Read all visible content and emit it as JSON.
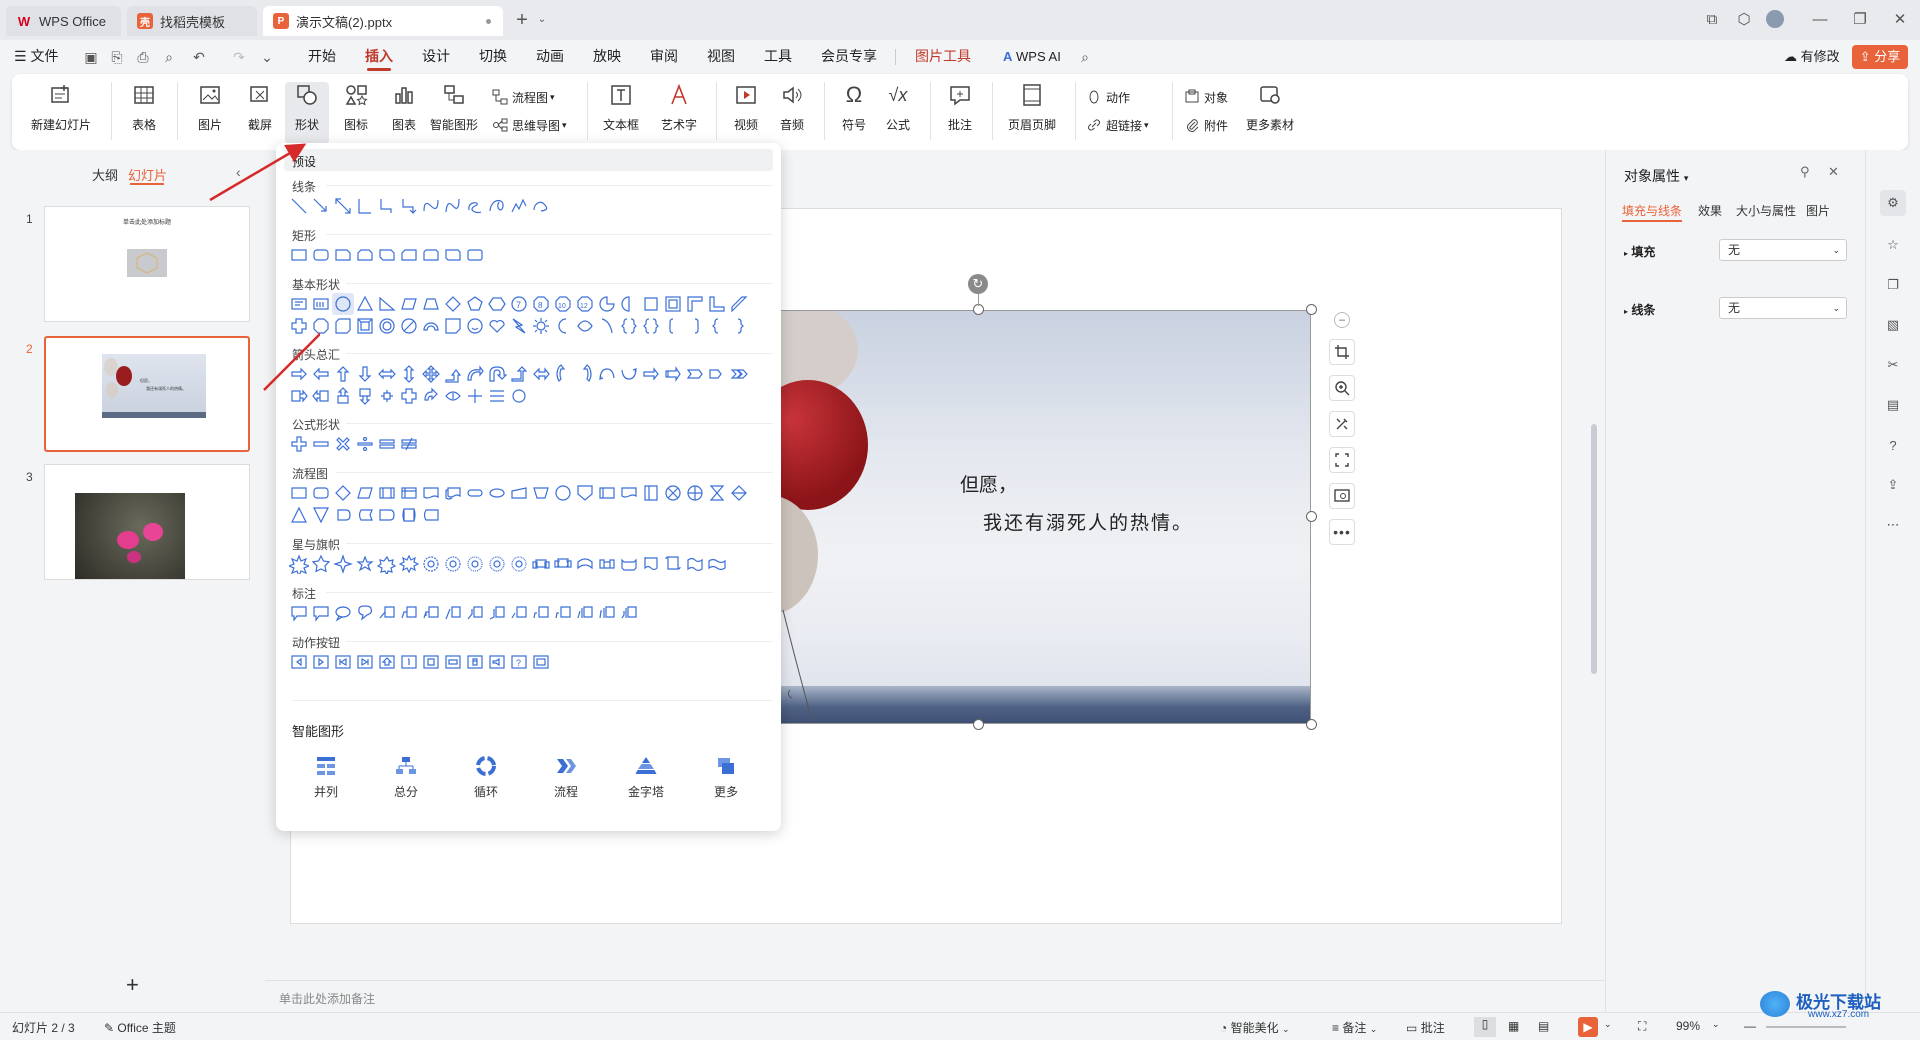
{
  "tabs": [
    {
      "label": "WPS Office",
      "color": "#d9001b"
    },
    {
      "label": "找稻壳模板",
      "color": "#e8623a"
    },
    {
      "label": "演示文稿(2).pptx",
      "color": "#e8623a"
    }
  ],
  "menu": {
    "file": "文件",
    "items": [
      "开始",
      "插入",
      "设计",
      "切换",
      "动画",
      "放映",
      "审阅",
      "视图",
      "工具",
      "会员专享"
    ],
    "active": "插入",
    "picture_tools": "图片工具",
    "wps_ai": "WPS AI",
    "has_changes": "有修改",
    "share": "分享"
  },
  "ribbon": {
    "new_slide": "新建幻灯片",
    "table": "表格",
    "picture": "图片",
    "screenshot": "截屏",
    "shape": "形状",
    "icon": "图标",
    "chart": "图表",
    "smartart": "智能图形",
    "flowchart": "流程图",
    "mindmap": "思维导图",
    "textbox": "文本框",
    "wordart": "艺术字",
    "video": "视频",
    "audio": "音频",
    "symbol": "符号",
    "formula": "公式",
    "comment": "批注",
    "header_footer": "页眉页脚",
    "action": "动作",
    "hyperlink": "超链接",
    "object": "对象",
    "attachment": "附件",
    "more_material": "更多素材"
  },
  "left_panel": {
    "tab_outline": "大纲",
    "tab_slides": "幻灯片",
    "slides": [
      {
        "num": "1",
        "title": "单击此处添加标题"
      },
      {
        "num": "2",
        "text1": "但愿，",
        "text2": "我还有溺死人的热情。"
      },
      {
        "num": "3"
      }
    ],
    "add": "+"
  },
  "slide": {
    "line1": "但愿，",
    "line2": "我还有溺死人的热情。"
  },
  "shapes_dropdown": {
    "preset": "预设",
    "sections": [
      {
        "title": "线条",
        "count": 12
      },
      {
        "title": "矩形",
        "count": 9
      },
      {
        "title": "基本形状",
        "count": 42
      },
      {
        "title": "箭头总汇",
        "count": 32
      },
      {
        "title": "公式形状",
        "count": 6
      },
      {
        "title": "流程图",
        "count": 28
      },
      {
        "title": "星与旗帜",
        "count": 20
      },
      {
        "title": "标注",
        "count": 16
      },
      {
        "title": "动作按钮",
        "count": 12
      }
    ],
    "smart_title": "智能图形",
    "smart_items": [
      "并列",
      "总分",
      "循环",
      "流程",
      "金字塔",
      "更多"
    ]
  },
  "right_panel": {
    "title": "对象属性",
    "tabs": [
      "填充与线条",
      "效果",
      "大小与属性",
      "图片"
    ],
    "fill_label": "填充",
    "fill_value": "无",
    "line_label": "线条",
    "line_value": "无"
  },
  "notes_placeholder": "单击此处添加备注",
  "status": {
    "slide_info": "幻灯片 2 / 3",
    "theme": "Office 主题",
    "beautify": "智能美化",
    "notes": "备注",
    "comment": "批注",
    "zoom": "99%"
  },
  "watermark": {
    "cn": "极光下载站",
    "url": "www.xz7.com"
  },
  "colors": {
    "accent": "#e8623a",
    "red_arrow": "#d62a2a",
    "shape_blue": "#3b6fd6"
  }
}
